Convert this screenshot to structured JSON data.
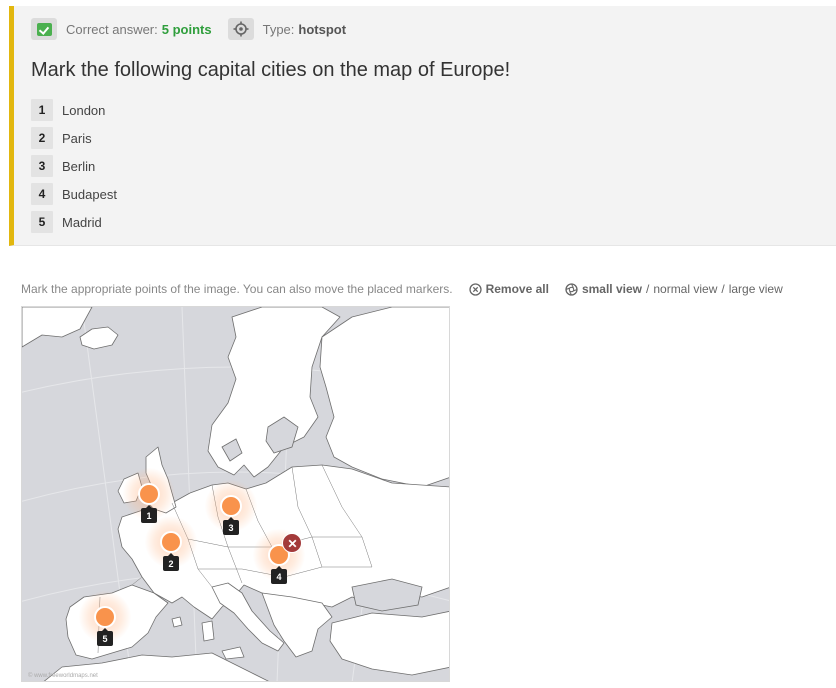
{
  "meta": {
    "correct_answer_label": "Correct answer:",
    "points": "5 points",
    "type_label": "Type:",
    "type_value": "hotspot",
    "colors": {
      "accent": "#e2b70e",
      "points": "#2f9e3c",
      "marker": "#f9934c",
      "remove": "#a33a3a"
    }
  },
  "question": {
    "title": "Mark the following capital cities on the map of Europe!",
    "answers": [
      {
        "num": "1",
        "label": "London"
      },
      {
        "num": "2",
        "label": "Paris"
      },
      {
        "num": "3",
        "label": "Berlin"
      },
      {
        "num": "4",
        "label": "Budapest"
      },
      {
        "num": "5",
        "label": "Madrid"
      }
    ]
  },
  "toolbar": {
    "instruction": "Mark the appropriate points of the image. You can also move the placed markers.",
    "remove_all": "Remove all",
    "views": [
      "small view",
      "normal view",
      "large view"
    ],
    "active_view": "small view"
  },
  "map": {
    "copyright": "© www.freeworldmaps.net",
    "markers": [
      {
        "label": "1"
      },
      {
        "label": "2"
      },
      {
        "label": "3"
      },
      {
        "label": "4",
        "selected": true
      },
      {
        "label": "5"
      }
    ]
  }
}
